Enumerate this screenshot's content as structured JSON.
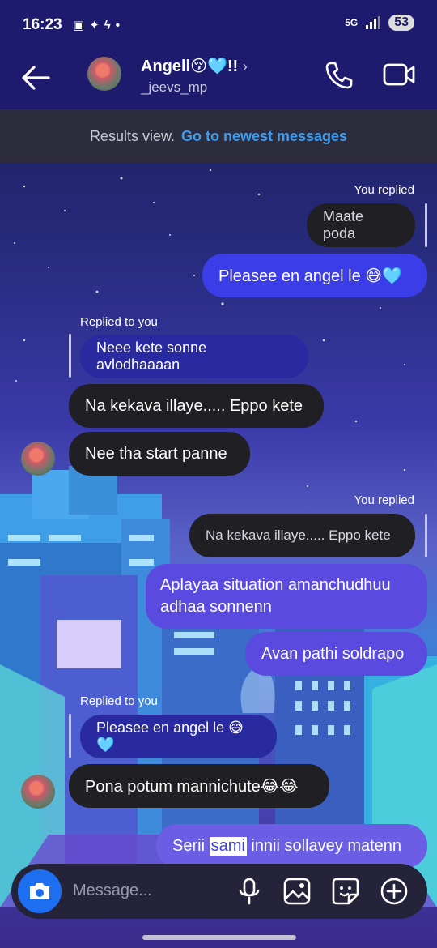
{
  "status": {
    "time": "16:23",
    "network": "5G",
    "battery": "53"
  },
  "header": {
    "name": "Angell😚🩵!!",
    "handle": "_jeevs_mp"
  },
  "banner": {
    "text": "Results view.",
    "link": "Go to newest messages"
  },
  "messages": {
    "m1_meta": "You replied",
    "m1_quoted": "Maate poda",
    "m1_text": "Pleasee en angel le 😅🩵",
    "m2_meta": "Replied to you",
    "m2_quoted": "Neee kete sonne avlodhaaaan",
    "m3_text": "Na kekava illaye..... Eppo kete",
    "m4_text": "Nee tha start panne",
    "m5_meta": "You replied",
    "m5_quoted": "Na kekava illaye..... Eppo kete",
    "m5_text_line1": "Aplayaa situation amanchudhuu",
    "m5_text_line2": "adhaa sonnenn",
    "m6_text": "Avan pathi soldrapo",
    "m7_meta": "Replied to you",
    "m7_quoted": "Pleasee en angel le 😅🩵",
    "m7_text": "Pona potum mannichute😂😂",
    "m8_pre": "Serii ",
    "m8_sel": "sami",
    "m8_post": " innii sollavey matenn"
  },
  "composer": {
    "placeholder": "Message..."
  },
  "colors": {
    "accent": "#3b3ee8",
    "link": "#3b9cf0",
    "header_bg": "#1e1a6e"
  }
}
